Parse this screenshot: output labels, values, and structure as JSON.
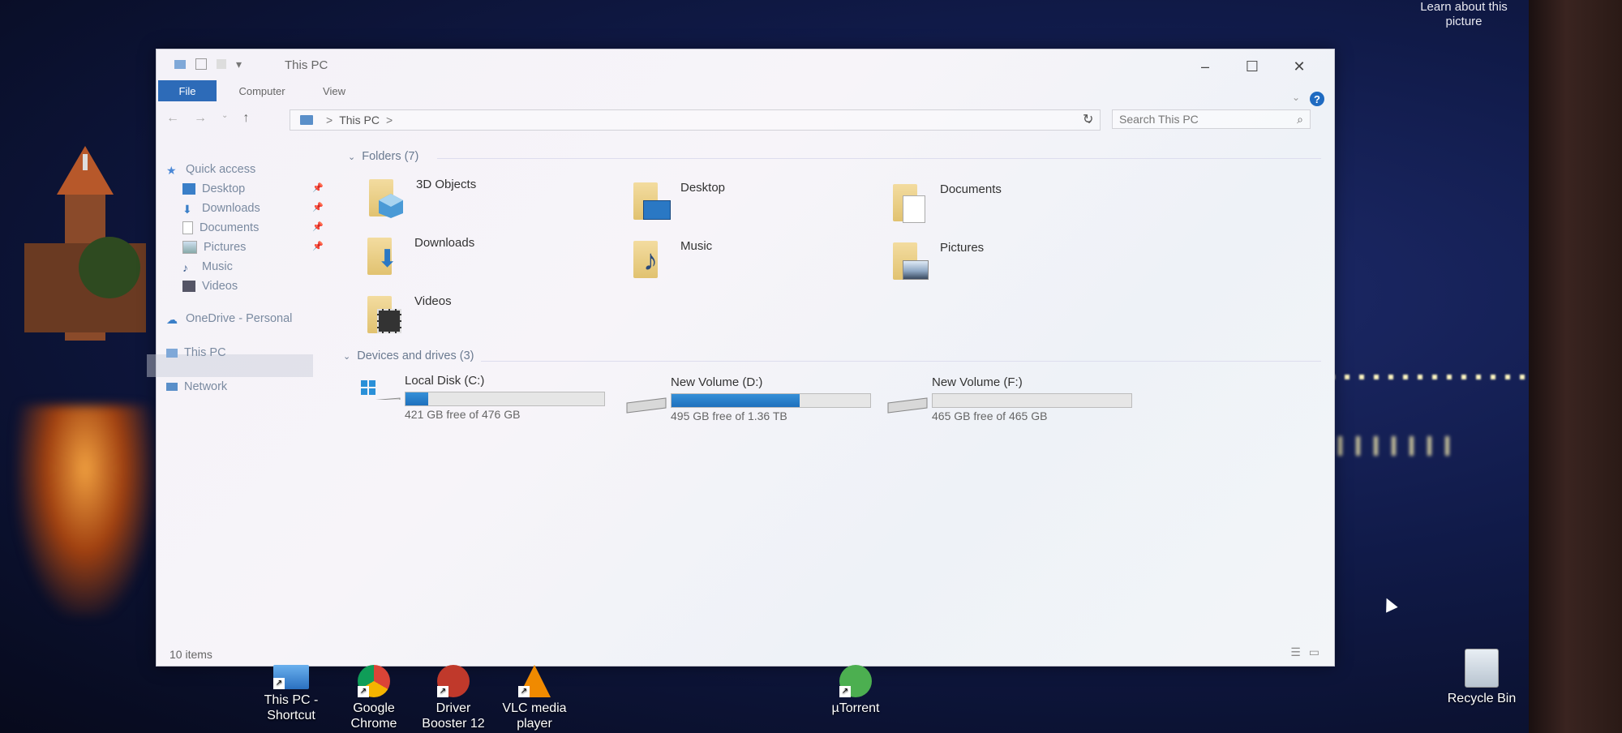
{
  "desktop": {
    "learn_about": "Learn about this picture",
    "icons": [
      {
        "label": "This PC - Shortcut",
        "icon": "this-pc-shortcut-icon"
      },
      {
        "label": "Google Chrome",
        "icon": "chrome-icon"
      },
      {
        "label": "Driver Booster 12",
        "icon": "driver-booster-icon"
      },
      {
        "label": "VLC media player",
        "icon": "vlc-icon"
      },
      {
        "label": "µTorrent",
        "icon": "utorrent-icon"
      },
      {
        "label": "Recycle Bin",
        "icon": "recycle-bin-icon"
      }
    ]
  },
  "window": {
    "title": "This PC",
    "ribbon_tabs": [
      "File",
      "Computer",
      "View"
    ],
    "address": {
      "path": "This PC",
      "separator": ">"
    },
    "search_placeholder": "Search This PC",
    "sidebar": {
      "quick_access": "Quick access",
      "items": [
        {
          "label": "Desktop",
          "pinned": true
        },
        {
          "label": "Downloads",
          "pinned": true
        },
        {
          "label": "Documents",
          "pinned": true
        },
        {
          "label": "Pictures",
          "pinned": true
        },
        {
          "label": "Music",
          "pinned": false
        },
        {
          "label": "Videos",
          "pinned": false
        }
      ],
      "onedrive": "OneDrive - Personal",
      "this_pc": "This PC",
      "network": "Network"
    },
    "folders_header": "Folders (7)",
    "folders": [
      "3D Objects",
      "Desktop",
      "Documents",
      "Downloads",
      "Music",
      "Pictures",
      "Videos"
    ],
    "drives_header": "Devices and drives (3)",
    "drives": [
      {
        "name": "Local Disk (C:)",
        "free": "421 GB free of 476 GB",
        "used_fraction": 0.115
      },
      {
        "name": "New Volume (D:)",
        "free": "495 GB free of 1.36 TB",
        "used_fraction": 0.645
      },
      {
        "name": "New Volume (F:)",
        "free": "465 GB free of 465 GB",
        "used_fraction": 0.0
      }
    ],
    "status": "10 items"
  },
  "colors": {
    "accent": "#2d6bb8",
    "drive_fill": "#1f70bd"
  }
}
